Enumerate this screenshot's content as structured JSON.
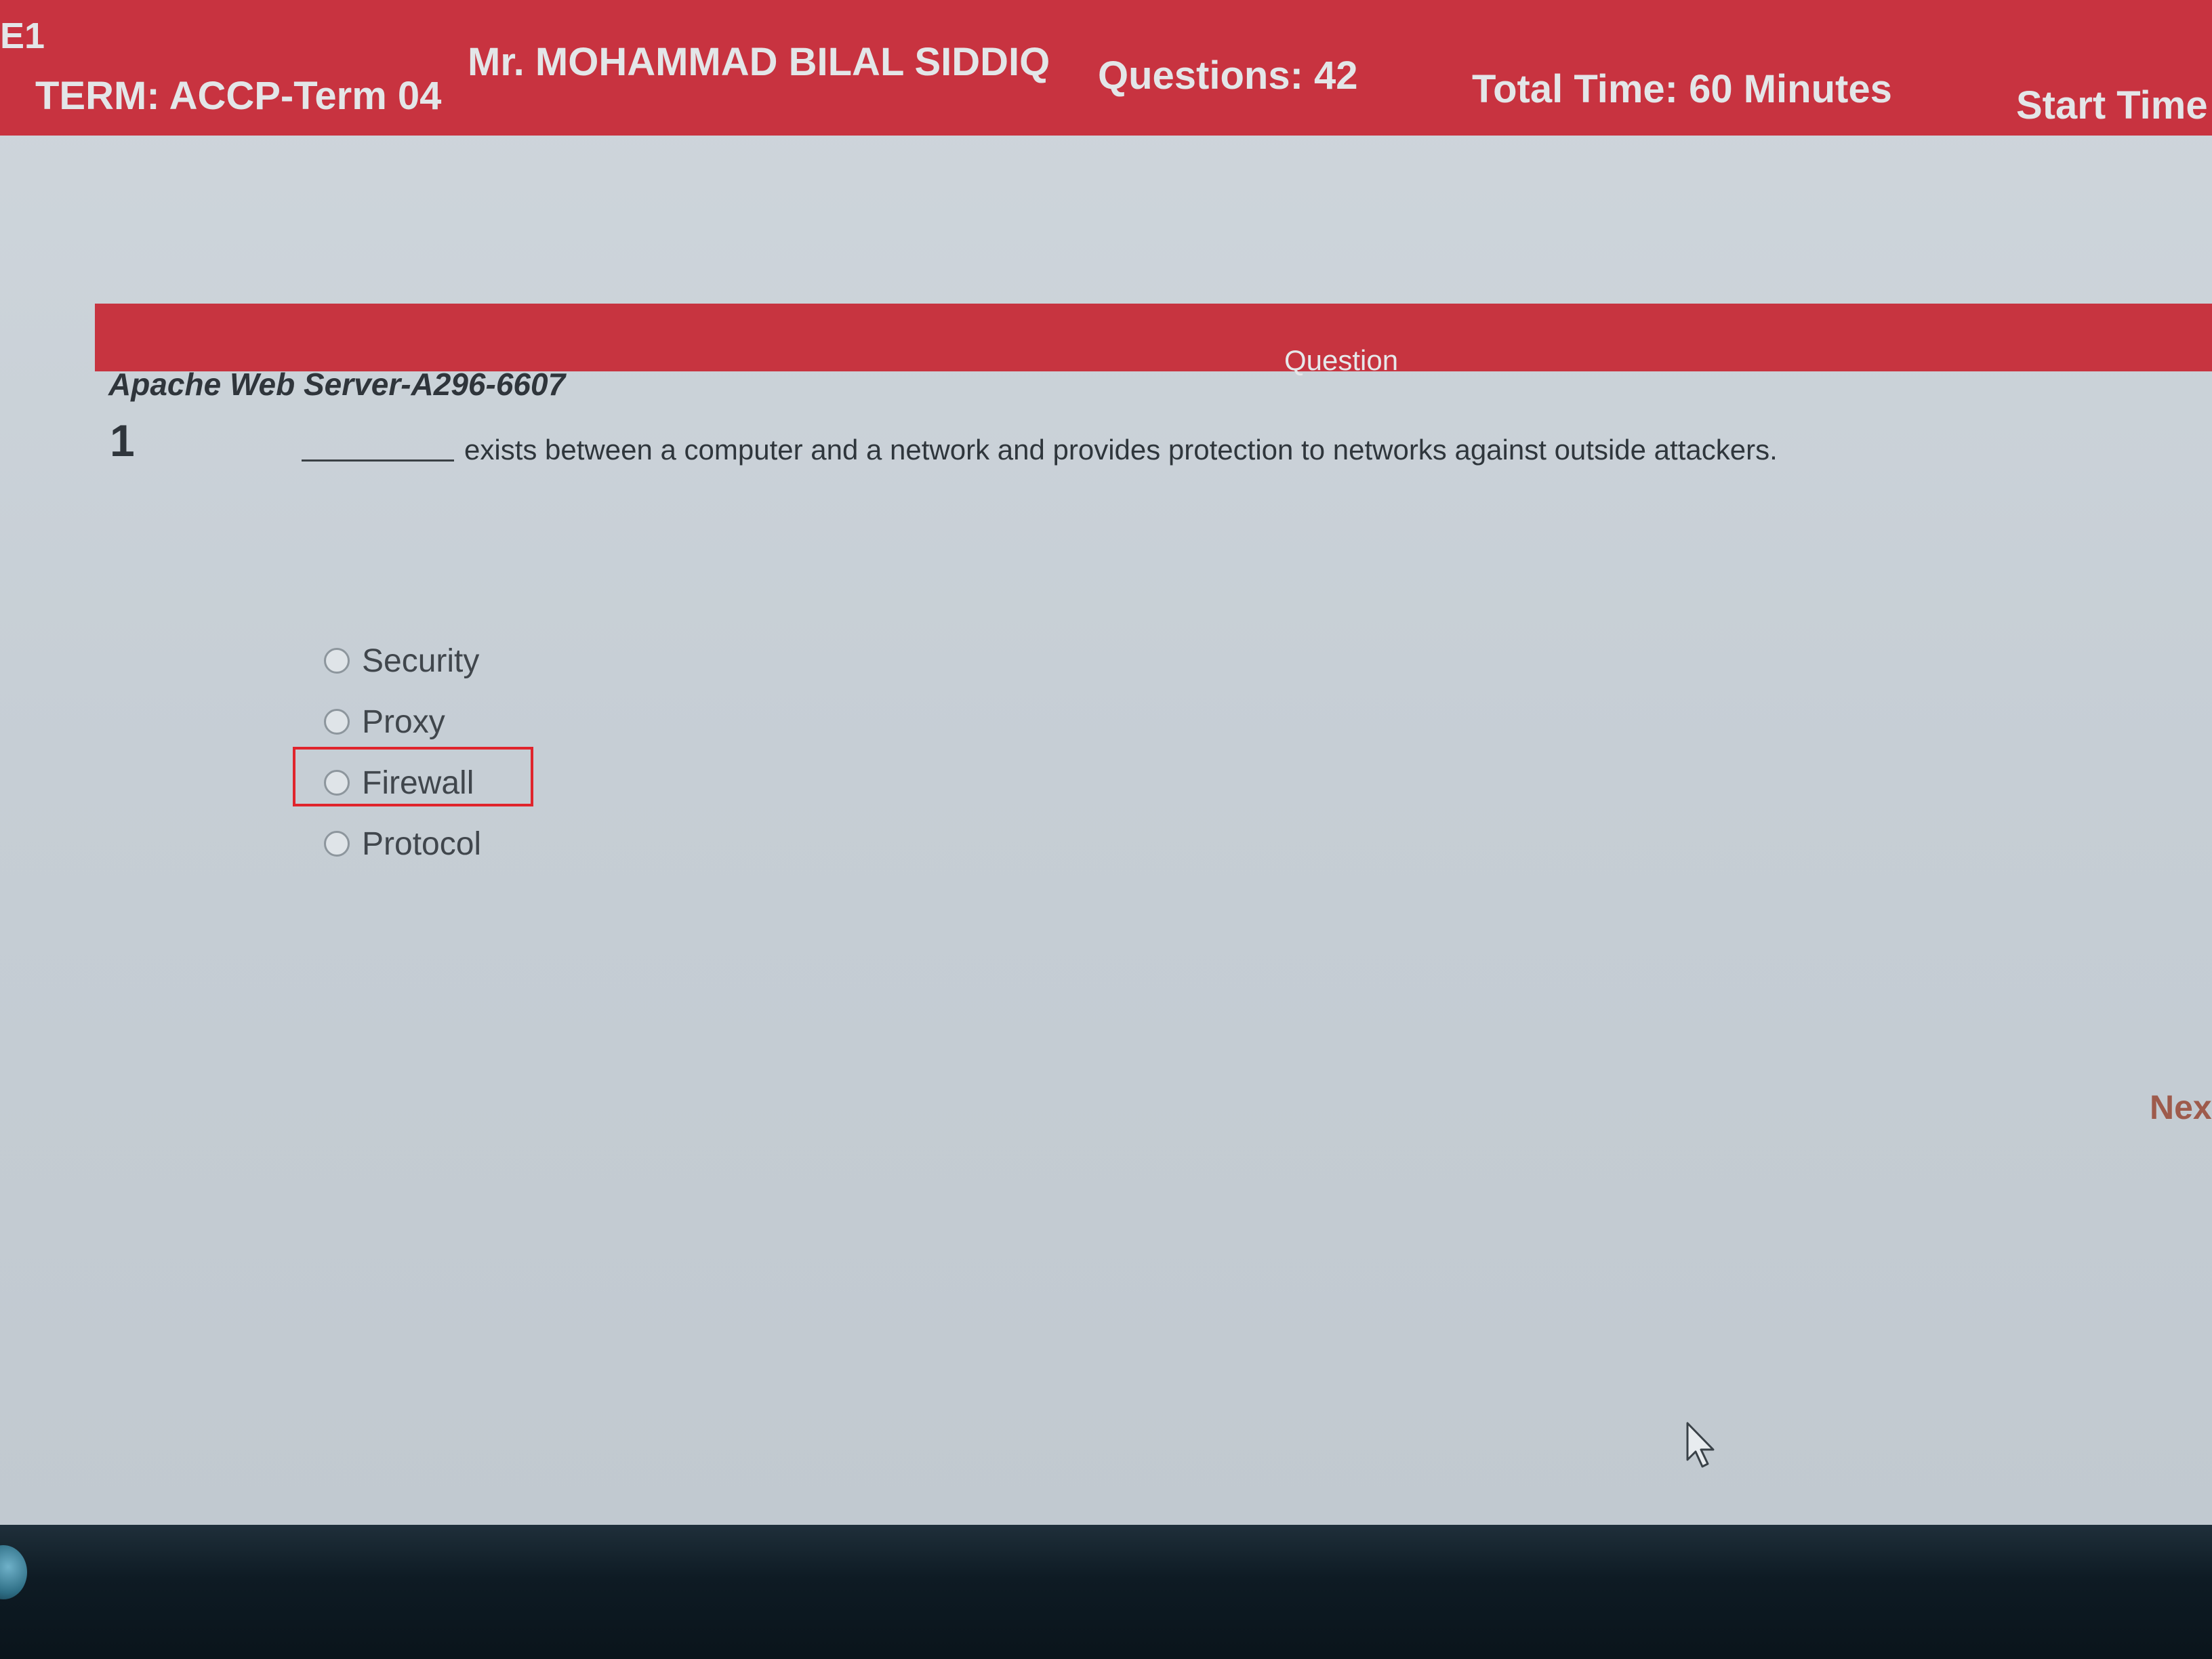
{
  "header": {
    "exam_code": "E1",
    "term": "TERM: ACCP-Term 04",
    "student_name": "Mr. MOHAMMAD BILAL SIDDIQ",
    "questions": "Questions:  42",
    "total_time": "Total Time:  60 Minutes",
    "start_time": "Start Time"
  },
  "question_bar": {
    "label": "Question"
  },
  "question": {
    "subject": "Apache Web Server-A296-6607",
    "number": "1",
    "text": "exists between a computer and a network and provides protection to networks against outside attackers.",
    "options": [
      "Security",
      "Proxy",
      "Firewall",
      "Protocol"
    ],
    "highlighted_option": "Firewall"
  },
  "navigation": {
    "next_label": "Nex"
  },
  "colors": {
    "header_red": "#c83340",
    "highlight_box": "#e0242c",
    "taskbar": "#0e1b24"
  }
}
